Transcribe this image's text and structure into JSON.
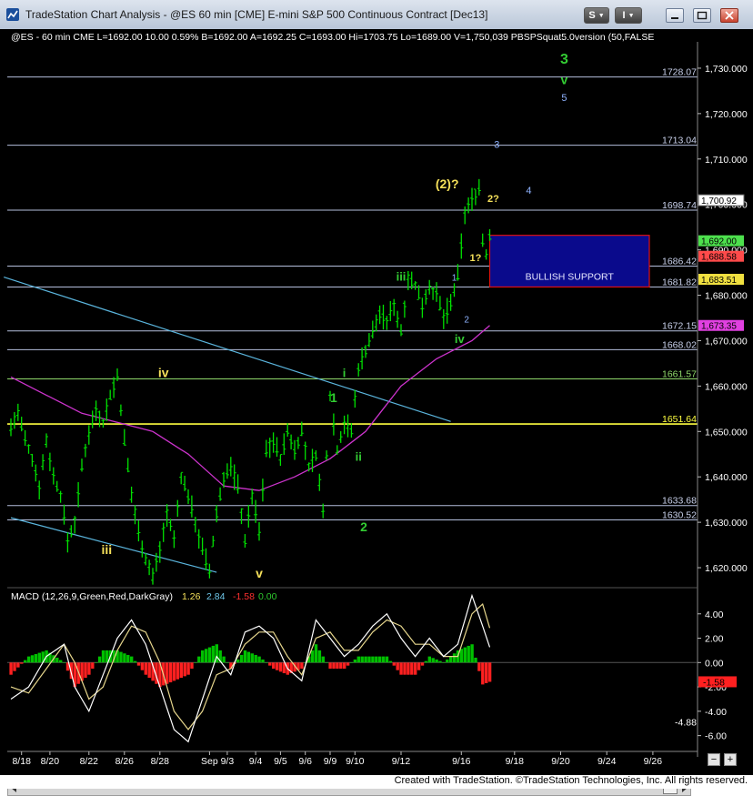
{
  "window": {
    "title": "TradeStation Chart Analysis - @ES 60 min [CME] E-mini S&P 500 Continuous Contract [Dec13]",
    "btn_s": "S",
    "btn_i": "I"
  },
  "status_bar": {
    "text": "@ES - 60 min   CME   L=1692.00   10.00   0.59%   B=1692.00   A=1692.25   C=1693.00   Hi=1703.75   Lo=1689.00   V=1,750,039   PBSPSquat5.0version (50,FALSE"
  },
  "footer": {
    "text": "Created with TradeStation. ©TradeStation Technologies, Inc. All rights reserved."
  },
  "colors": {
    "background": "#000000",
    "price": "#00e000",
    "ma": "#cc33cc",
    "channel": "#5ab4dc",
    "support_fill": "#0a0a8c",
    "support_border": "#dd1010",
    "hline": "#b4bedc",
    "yellow_line": "#ffff40",
    "macd_line": "#ffffff",
    "signal_line": "#e6d68c",
    "hist_pos": "#00c000",
    "hist_neg": "#ff2020"
  },
  "chart_data": [
    {
      "type": "line",
      "name": "price",
      "x_ticks": [
        "8/18",
        "8/20",
        "8/22",
        "8/26",
        "8/28",
        "Sep",
        "9/3",
        "9/4",
        "9/5",
        "9/6",
        "9/9",
        "9/10",
        "9/12",
        "9/16",
        "9/18",
        "9/20",
        "9/24",
        "9/26"
      ],
      "y_ticks": [
        1620,
        1630,
        1640,
        1650,
        1660,
        1670,
        1680,
        1690,
        1700,
        1710,
        1720,
        1730
      ],
      "ylim": [
        1616,
        1735
      ],
      "path": [
        [
          0,
          1651
        ],
        [
          2,
          1654
        ],
        [
          4,
          1648
        ],
        [
          6,
          1644
        ],
        [
          8,
          1638
        ],
        [
          10,
          1648
        ],
        [
          12,
          1640
        ],
        [
          14,
          1636
        ],
        [
          16,
          1626
        ],
        [
          18,
          1630
        ],
        [
          20,
          1642
        ],
        [
          22,
          1650
        ],
        [
          24,
          1655
        ],
        [
          26,
          1652
        ],
        [
          28,
          1658
        ],
        [
          30,
          1662
        ],
        [
          32,
          1648
        ],
        [
          34,
          1636
        ],
        [
          36,
          1628
        ],
        [
          38,
          1622
        ],
        [
          40,
          1618
        ],
        [
          42,
          1624
        ],
        [
          44,
          1632
        ],
        [
          46,
          1626
        ],
        [
          48,
          1640
        ],
        [
          50,
          1636
        ],
        [
          52,
          1630
        ],
        [
          54,
          1624
        ],
        [
          56,
          1619
        ],
        [
          58,
          1632
        ],
        [
          60,
          1640
        ],
        [
          62,
          1642
        ],
        [
          64,
          1638
        ],
        [
          66,
          1626
        ],
        [
          68,
          1636
        ],
        [
          70,
          1628
        ],
        [
          72,
          1646
        ],
        [
          74,
          1648
        ],
        [
          76,
          1644
        ],
        [
          78,
          1650
        ],
        [
          80,
          1646
        ],
        [
          82,
          1650
        ],
        [
          84,
          1642
        ],
        [
          86,
          1645
        ],
        [
          88,
          1632
        ],
        [
          90,
          1658
        ],
        [
          92,
          1646
        ],
        [
          94,
          1652
        ],
        [
          96,
          1650
        ],
        [
          98,
          1664
        ],
        [
          100,
          1668
        ],
        [
          102,
          1672
        ],
        [
          104,
          1676
        ],
        [
          106,
          1674
        ],
        [
          108,
          1678
        ],
        [
          110,
          1672
        ],
        [
          112,
          1684
        ],
        [
          114,
          1682
        ],
        [
          116,
          1678
        ],
        [
          118,
          1682
        ],
        [
          120,
          1680
        ],
        [
          122,
          1675
        ],
        [
          124,
          1678
        ],
        [
          126,
          1684
        ],
        [
          128,
          1698
        ],
        [
          130,
          1701
        ],
        [
          132,
          1703.75
        ],
        [
          133,
          1692
        ],
        [
          134,
          1689
        ],
        [
          135,
          1693
        ]
      ],
      "n_bars": 190
    },
    {
      "type": "line",
      "name": "moving-average",
      "path": [
        [
          0,
          1662
        ],
        [
          10,
          1658
        ],
        [
          20,
          1654
        ],
        [
          30,
          1652
        ],
        [
          40,
          1650
        ],
        [
          50,
          1645
        ],
        [
          60,
          1638
        ],
        [
          70,
          1637
        ],
        [
          80,
          1640
        ],
        [
          90,
          1644
        ],
        [
          100,
          1650
        ],
        [
          110,
          1660
        ],
        [
          120,
          1666
        ],
        [
          130,
          1670
        ],
        [
          135,
          1673.35
        ]
      ]
    },
    {
      "type": "annotation",
      "name": "horizontal-levels",
      "levels": [
        {
          "value": 1728.07,
          "label": "1728.07",
          "color": "#b4bedc"
        },
        {
          "value": 1713.04,
          "label": "1713.04",
          "color": "#b4bedc"
        },
        {
          "value": 1698.74,
          "label": "1698.74",
          "color": "#b4bedc"
        },
        {
          "value": 1686.42,
          "label": "1686.42",
          "color": "#b4bedc"
        },
        {
          "value": 1681.82,
          "label": "1681.82",
          "color": "#b4bedc"
        },
        {
          "value": 1672.15,
          "label": "1672.15",
          "color": "#b4bedc"
        },
        {
          "value": 1668.02,
          "label": "1668.02",
          "color": "#b4bedc"
        },
        {
          "value": 1661.57,
          "label": "1661.57",
          "color": "#8fd86a"
        },
        {
          "value": 1651.64,
          "label": "1651.64",
          "color": "#ffff40"
        },
        {
          "value": 1633.68,
          "label": "1633.68",
          "color": "#b4bedc"
        },
        {
          "value": 1630.52,
          "label": "1630.52",
          "color": "#b4bedc"
        }
      ],
      "support_zone": {
        "label": "BULLISH SUPPORT",
        "low": 1681.82,
        "high": 1693.2,
        "x_start": 135,
        "x_end": 180
      },
      "price_tags": [
        {
          "value": 1700.92,
          "label": "1,700.92",
          "bg": "#ffffff",
          "fg": "#000000",
          "outline": "#666666"
        },
        {
          "value": 1692.0,
          "label": "1,692.00",
          "bg": "#4de04d",
          "fg": "#000000"
        },
        {
          "value": 1688.58,
          "label": "1,688.58",
          "bg": "#ff4a4a",
          "fg": "#000000"
        },
        {
          "value": 1683.51,
          "label": "1,683.51",
          "bg": "#f0e040",
          "fg": "#000000"
        },
        {
          "value": 1673.35,
          "label": "1,673.35",
          "bg": "#e040e0",
          "fg": "#000000"
        }
      ],
      "channel_lines": [
        {
          "from": [
            -2,
            1684
          ],
          "to": [
            124,
            1652.2
          ]
        },
        {
          "from": [
            0,
            1631
          ],
          "to": [
            58,
            1619
          ]
        }
      ],
      "wave_labels": [
        {
          "x": 156,
          "y": 1731,
          "text": "3",
          "color": "#33cc33",
          "size": 16,
          "weight": "bold"
        },
        {
          "x": 156,
          "y": 1726.5,
          "text": "v",
          "color": "#33cc33",
          "size": 14,
          "weight": "bold"
        },
        {
          "x": 156,
          "y": 1722.8,
          "text": "5",
          "color": "#8fb3ff",
          "size": 11,
          "weight": "normal"
        },
        {
          "x": 137,
          "y": 1712.5,
          "text": "3",
          "color": "#8fb3ff",
          "size": 11,
          "weight": "normal"
        },
        {
          "x": 146,
          "y": 1702.3,
          "text": "4",
          "color": "#8fb3ff",
          "size": 11,
          "weight": "normal"
        },
        {
          "x": 123,
          "y": 1703.5,
          "text": "(2)?",
          "color": "#f5e05a",
          "size": 14,
          "weight": "bold"
        },
        {
          "x": 136,
          "y": 1700.5,
          "text": "2?",
          "color": "#f5e05a",
          "size": 11,
          "weight": "bold"
        },
        {
          "x": 131,
          "y": 1687.5,
          "text": "1?",
          "color": "#f5e05a",
          "size": 11,
          "weight": "bold"
        },
        {
          "x": 110,
          "y": 1683.2,
          "text": "iii",
          "color": "#33cc33",
          "size": 13,
          "weight": "bold"
        },
        {
          "x": 125,
          "y": 1683.2,
          "text": "1",
          "color": "#8fb3ff",
          "size": 10,
          "weight": "normal"
        },
        {
          "x": 128.5,
          "y": 1674,
          "text": "2",
          "color": "#8fb3ff",
          "size": 10,
          "weight": "normal"
        },
        {
          "x": 126.5,
          "y": 1669.5,
          "text": "iv",
          "color": "#33cc33",
          "size": 13,
          "weight": "bold"
        },
        {
          "x": 94,
          "y": 1662,
          "text": "i",
          "color": "#33cc33",
          "size": 13,
          "weight": "bold"
        },
        {
          "x": 91,
          "y": 1656.5,
          "text": "1",
          "color": "#33cc33",
          "size": 14,
          "weight": "bold"
        },
        {
          "x": 98,
          "y": 1643.5,
          "text": "ii",
          "color": "#33cc33",
          "size": 13,
          "weight": "bold"
        },
        {
          "x": 99.5,
          "y": 1628,
          "text": "2",
          "color": "#33cc33",
          "size": 14,
          "weight": "bold"
        },
        {
          "x": 43,
          "y": 1662,
          "text": "iv",
          "color": "#f5e05a",
          "size": 14,
          "weight": "bold"
        },
        {
          "x": 27,
          "y": 1623,
          "text": "iii",
          "color": "#f5e05a",
          "size": 14,
          "weight": "bold"
        },
        {
          "x": 70,
          "y": 1617.8,
          "text": "v",
          "color": "#f5e05a",
          "size": 14,
          "weight": "bold"
        }
      ]
    },
    {
      "type": "line",
      "name": "MACD (12,26,9,Green,Red,DarkGray)",
      "legend": [
        {
          "text": "MACD (12,26,9,Green,Red,DarkGray)",
          "color": "#ffffff"
        },
        {
          "text": "1.26",
          "color": "#f5e05a"
        },
        {
          "text": "2.84",
          "color": "#6ec6e8"
        },
        {
          "text": "-1.58",
          "color": "#ff3030"
        },
        {
          "text": "0.00",
          "color": "#2ec82e"
        }
      ],
      "y_ticks": [
        -6,
        -4,
        -2,
        0,
        2,
        4
      ],
      "y_tick_labels": [
        "-6.00",
        "-4.00",
        "-2.00",
        "0.00",
        "2.00",
        "4.00"
      ],
      "ylim": [
        -7,
        6
      ],
      "level_tags": [
        {
          "value": -1.58,
          "label": "-1.58",
          "bg": "#ff2020",
          "fg": "#000000"
        },
        {
          "value": -4.88,
          "label": "-4.88",
          "bg": "none",
          "fg": "#ffffff"
        }
      ],
      "macd": [
        [
          0,
          -3
        ],
        [
          5,
          -2
        ],
        [
          10,
          0.5
        ],
        [
          15,
          1.5
        ],
        [
          18,
          -2
        ],
        [
          22,
          -4
        ],
        [
          26,
          -1
        ],
        [
          30,
          2
        ],
        [
          34,
          3.5
        ],
        [
          38,
          1.5
        ],
        [
          42,
          -2
        ],
        [
          46,
          -5.5
        ],
        [
          50,
          -6.5
        ],
        [
          54,
          -3
        ],
        [
          58,
          0.5
        ],
        [
          62,
          -1
        ],
        [
          66,
          2.5
        ],
        [
          70,
          3
        ],
        [
          74,
          2
        ],
        [
          78,
          -0.5
        ],
        [
          82,
          -1.5
        ],
        [
          86,
          3.5
        ],
        [
          90,
          2
        ],
        [
          94,
          0.5
        ],
        [
          98,
          1.5
        ],
        [
          102,
          3
        ],
        [
          106,
          4
        ],
        [
          110,
          2
        ],
        [
          114,
          0.5
        ],
        [
          118,
          2
        ],
        [
          122,
          0.5
        ],
        [
          126,
          1.5
        ],
        [
          130,
          5.5
        ],
        [
          133,
          3
        ],
        [
          135,
          1.26
        ]
      ],
      "signal": [
        [
          0,
          -2
        ],
        [
          5,
          -2.5
        ],
        [
          10,
          -0.5
        ],
        [
          15,
          1.5
        ],
        [
          18,
          0
        ],
        [
          22,
          -3
        ],
        [
          26,
          -2
        ],
        [
          30,
          1
        ],
        [
          34,
          3
        ],
        [
          38,
          2.5
        ],
        [
          42,
          0
        ],
        [
          46,
          -4
        ],
        [
          50,
          -5.5
        ],
        [
          54,
          -4
        ],
        [
          58,
          -1
        ],
        [
          62,
          -0.5
        ],
        [
          66,
          1.5
        ],
        [
          70,
          2.5
        ],
        [
          74,
          2.5
        ],
        [
          78,
          0.5
        ],
        [
          82,
          -1
        ],
        [
          86,
          2
        ],
        [
          90,
          2.5
        ],
        [
          94,
          1
        ],
        [
          98,
          1
        ],
        [
          102,
          2.5
        ],
        [
          106,
          3.5
        ],
        [
          110,
          3
        ],
        [
          114,
          1.5
        ],
        [
          118,
          1.5
        ],
        [
          122,
          0.5
        ],
        [
          126,
          0.5
        ],
        [
          130,
          4
        ],
        [
          133,
          4.8
        ],
        [
          135,
          2.84
        ]
      ]
    }
  ]
}
